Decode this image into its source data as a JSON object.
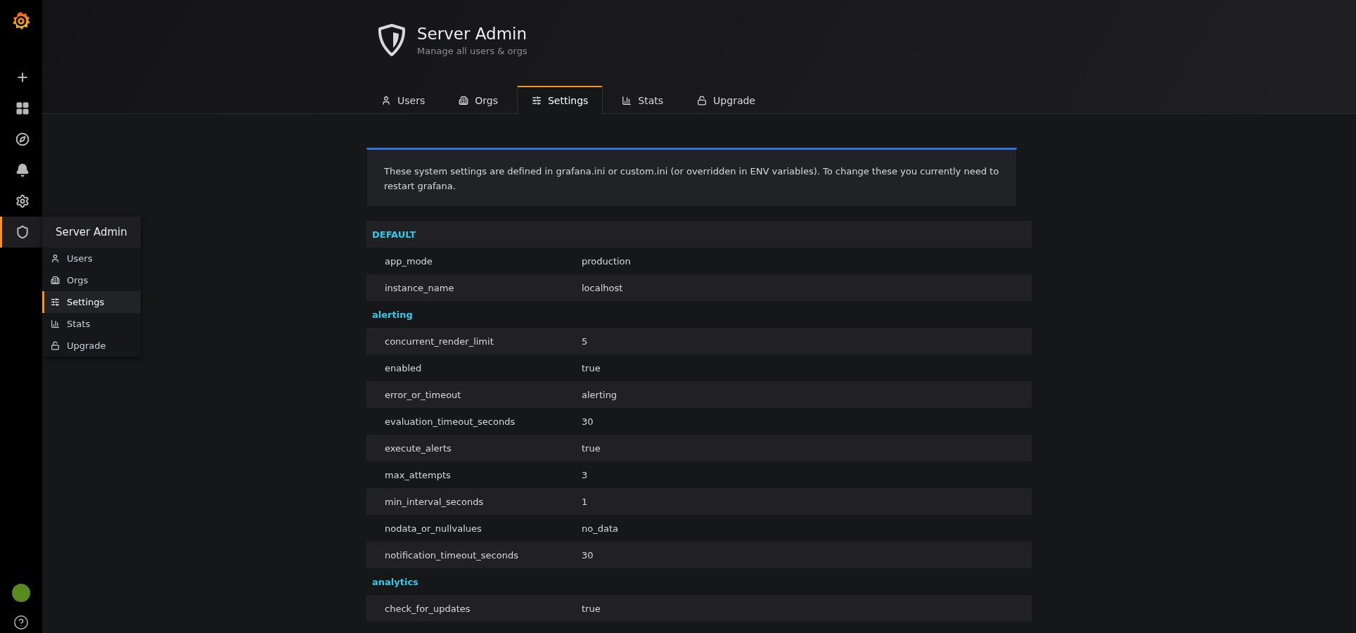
{
  "sidebar": {
    "items": [
      {
        "kind": "create",
        "selected": false
      },
      {
        "kind": "dashboards",
        "selected": false
      },
      {
        "kind": "explore",
        "selected": false
      },
      {
        "kind": "alerting",
        "selected": false
      },
      {
        "kind": "configuration",
        "selected": false
      },
      {
        "kind": "admin",
        "selected": true
      }
    ],
    "menu": {
      "title": "Server Admin",
      "items": [
        {
          "label": "Users",
          "kind": "users",
          "selected": false
        },
        {
          "label": "Orgs",
          "kind": "orgs",
          "selected": false
        },
        {
          "label": "Settings",
          "kind": "settings",
          "selected": true
        },
        {
          "label": "Stats",
          "kind": "stats",
          "selected": false
        },
        {
          "label": "Upgrade",
          "kind": "upgrade",
          "selected": false
        }
      ]
    }
  },
  "page_header": {
    "title": "Server Admin",
    "subtitle": "Manage all users & orgs",
    "tabs": [
      {
        "label": "Users",
        "kind": "users",
        "selected": false
      },
      {
        "label": "Orgs",
        "kind": "orgs",
        "selected": false
      },
      {
        "label": "Settings",
        "kind": "settings",
        "selected": true
      },
      {
        "label": "Stats",
        "kind": "stats",
        "selected": false
      },
      {
        "label": "Upgrade",
        "kind": "upgrade",
        "selected": false
      }
    ]
  },
  "info_text": "These system settings are defined in grafana.ini or custom.ini (or overridden in ENV variables). To change these you currently need to restart grafana.",
  "settings": [
    {
      "section": "DEFAULT",
      "rows": [
        {
          "key": "app_mode",
          "value": "production"
        },
        {
          "key": "instance_name",
          "value": "localhost"
        }
      ]
    },
    {
      "section": "alerting",
      "rows": [
        {
          "key": "concurrent_render_limit",
          "value": "5"
        },
        {
          "key": "enabled",
          "value": "true"
        },
        {
          "key": "error_or_timeout",
          "value": "alerting"
        },
        {
          "key": "evaluation_timeout_seconds",
          "value": "30"
        },
        {
          "key": "execute_alerts",
          "value": "true"
        },
        {
          "key": "max_attempts",
          "value": "3"
        },
        {
          "key": "min_interval_seconds",
          "value": "1"
        },
        {
          "key": "nodata_or_nullvalues",
          "value": "no_data"
        },
        {
          "key": "notification_timeout_seconds",
          "value": "30"
        }
      ]
    },
    {
      "section": "analytics",
      "rows": [
        {
          "key": "check_for_updates",
          "value": "true"
        }
      ]
    }
  ]
}
